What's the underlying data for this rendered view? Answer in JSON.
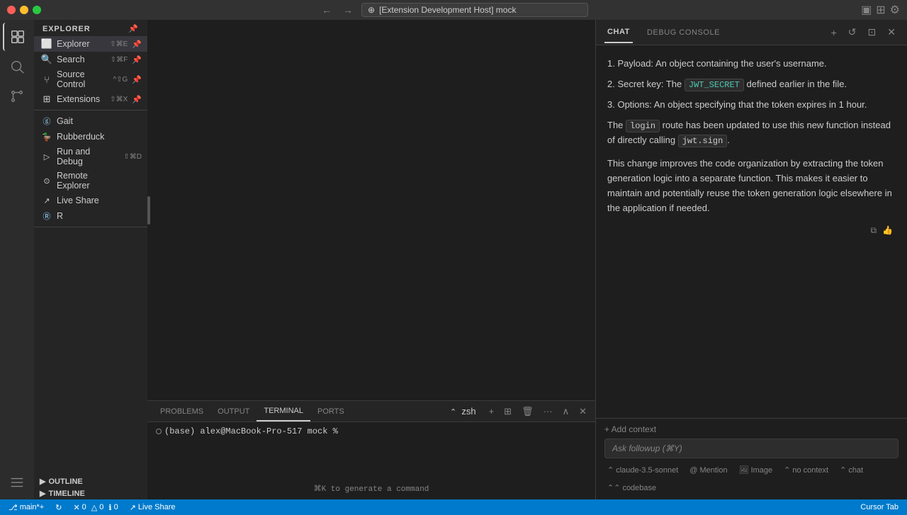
{
  "titlebar": {
    "title": "[Extension Development Host] mock",
    "search_placeholder": "[Extension Development Host] mock"
  },
  "activity_bar": {
    "items": [
      {
        "id": "explorer",
        "icon": "📁",
        "label": "Explorer"
      },
      {
        "id": "search",
        "icon": "🔍",
        "label": "Search"
      },
      {
        "id": "source-control",
        "icon": "⑂",
        "label": "Source Control"
      },
      {
        "id": "collapse",
        "icon": "≡",
        "label": "Collapse"
      }
    ]
  },
  "sidebar": {
    "section_title": "EXPLORER",
    "items": [
      {
        "id": "explorer",
        "label": "Explorer",
        "shortcut": "⇧⌘E",
        "pinned": true,
        "active": true
      },
      {
        "id": "search",
        "label": "Search",
        "shortcut": "⇧⌘F",
        "pinned": true
      },
      {
        "id": "source-control",
        "label": "Source Control",
        "shortcut": "^⇧G",
        "pinned": true
      },
      {
        "id": "extensions",
        "label": "Extensions",
        "shortcut": "⇧⌘X",
        "pinned": true
      },
      {
        "id": "gait",
        "label": "Gait"
      },
      {
        "id": "rubberduck",
        "label": "Rubberduck"
      },
      {
        "id": "run-debug",
        "label": "Run and Debug",
        "shortcut": "⇧⌘D"
      },
      {
        "id": "remote-explorer",
        "label": "Remote Explorer"
      },
      {
        "id": "live-share",
        "label": "Live Share"
      },
      {
        "id": "r",
        "label": "R"
      }
    ],
    "outline_label": "OUTLINE",
    "timeline_label": "TIMELINE"
  },
  "chat": {
    "tab_chat": "CHAT",
    "tab_debug_console": "DEBUG CONSOLE",
    "content": {
      "item1_prefix": "1. Payload: An object containing the user's username.",
      "item2_prefix": "2. Secret key: The ",
      "item2_code": "JWT_SECRET",
      "item2_suffix": " defined earlier in the file.",
      "item3": "3. Options: An object specifying that the token expires in 1 hour.",
      "para1_prefix": "The ",
      "para1_code": "login",
      "para1_suffix": " route has been updated to use this new function instead of directly calling ",
      "para1_code2": "jwt.sign",
      "para1_suffix2": ".",
      "para2": "This change improves the code organization by extracting the token generation logic into a separate function. This makes it easier to maintain and potentially reuse the token generation logic elsewhere in the application if needed."
    },
    "add_context_label": "+ Add context",
    "input_placeholder": "Ask followup (⌘Y)",
    "footer": {
      "model": "claude-3.5-sonnet",
      "mention": "Mention",
      "image": "Image",
      "context": "no context",
      "chat": "chat",
      "codebase": "codebase"
    }
  },
  "panel": {
    "tabs": [
      "PROBLEMS",
      "OUTPUT",
      "TERMINAL",
      "PORTS"
    ],
    "active_tab": "TERMINAL",
    "terminal_shell": "zsh",
    "terminal_prompt": "(base)  alex@MacBook-Pro-517 mock %",
    "generate_hint": "⌘K to generate a command"
  },
  "statusbar": {
    "branch_icon": "⎇",
    "branch": "main*+",
    "sync_icon": "↻",
    "errors": "0",
    "warnings": "0",
    "info": "0",
    "live_share": "Live Share",
    "cursor_tab": "Cursor Tab"
  }
}
